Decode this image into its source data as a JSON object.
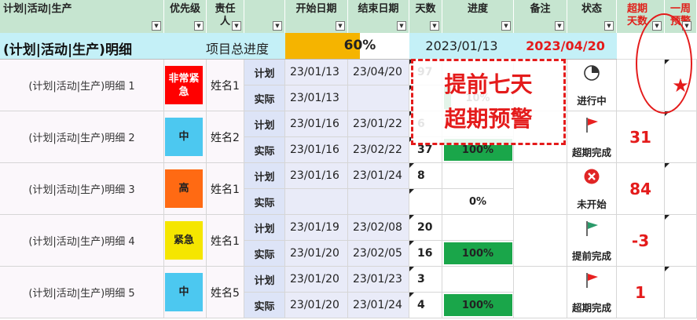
{
  "columns": {
    "name": "计划|活动|生产",
    "priority": "优先级",
    "owner_line1": "责任",
    "owner_line2": "人",
    "start": "开始日期",
    "end": "结束日期",
    "days": "天数",
    "progress": "进度",
    "note": "备注",
    "status": "状态",
    "overdue_line1": "超期",
    "overdue_line2": "天数",
    "weekwarn_line1": "一周",
    "weekwarn_line2": "预警"
  },
  "summary": {
    "title": "(计划|活动|生产)明细",
    "total_label": "项目总进度",
    "total_pct": "60%",
    "total_fraction": 0.6,
    "today": "2023/01/13",
    "deadline": "2023/04/20"
  },
  "callout": {
    "line1": "提前七天",
    "line2": "超期预警"
  },
  "labels": {
    "plan": "计划",
    "actual": "实际"
  },
  "rows": [
    {
      "name": "(计划|活动|生产)明细 1",
      "priority": "非常紧急",
      "priority_color": "#ff0000",
      "priority_text_color": "#ffffff",
      "owner": "姓名1",
      "plan_start": "23/01/13",
      "plan_end": "23/04/20",
      "plan_days": "97",
      "act_start": "23/01/13",
      "act_end": "",
      "act_days": "",
      "progress": "10%",
      "progress_fraction": 0.1,
      "status": "进行中",
      "status_icon": "pie-clock-icon",
      "overdue": "",
      "warn": "★"
    },
    {
      "name": "(计划|活动|生产)明细 2",
      "priority": "中",
      "priority_color": "#4cc8f0",
      "priority_text_color": "#222222",
      "owner": "姓名2",
      "plan_start": "23/01/16",
      "plan_end": "23/01/22",
      "plan_days": "6",
      "act_start": "23/01/16",
      "act_end": "23/02/22",
      "act_days": "37",
      "progress": "100%",
      "progress_fraction": 1.0,
      "status": "超期完成",
      "status_icon": "red-flag-icon",
      "overdue": "31",
      "warn": ""
    },
    {
      "name": "(计划|活动|生产)明细 3",
      "priority": "高",
      "priority_color": "#ff6a13",
      "priority_text_color": "#222222",
      "owner": "姓名1",
      "plan_start": "23/01/16",
      "plan_end": "23/01/24",
      "plan_days": "8",
      "act_start": "",
      "act_end": "",
      "act_days": "",
      "progress": "0%",
      "progress_fraction": 0,
      "status": "未开始",
      "status_icon": "red-x-circle-icon",
      "overdue": "84",
      "warn": ""
    },
    {
      "name": "(计划|活动|生产)明细 4",
      "priority": "紧急",
      "priority_color": "#f5e600",
      "priority_text_color": "#222222",
      "owner": "姓名1",
      "plan_start": "23/01/19",
      "plan_end": "23/02/08",
      "plan_days": "20",
      "act_start": "23/01/20",
      "act_end": "23/02/05",
      "act_days": "16",
      "progress": "100%",
      "progress_fraction": 1.0,
      "status": "提前完成",
      "status_icon": "green-flag-icon",
      "overdue": "-3",
      "warn": ""
    },
    {
      "name": "(计划|活动|生产)明细 5",
      "priority": "中",
      "priority_color": "#4cc8f0",
      "priority_text_color": "#222222",
      "owner": "姓名5",
      "plan_start": "23/01/20",
      "plan_end": "23/01/23",
      "plan_days": "3",
      "act_start": "23/01/20",
      "act_end": "23/01/24",
      "act_days": "4",
      "progress": "100%",
      "progress_fraction": 1.0,
      "status": "超期完成",
      "status_icon": "red-flag-icon",
      "overdue": "1",
      "warn": ""
    }
  ],
  "colors": {
    "header_bg": "#c6e5d0",
    "summary_bg": "#c4f0f7",
    "progress_green": "#1aa64a",
    "summary_bar": "#f5b400",
    "alert_red": "#e41b1b"
  }
}
